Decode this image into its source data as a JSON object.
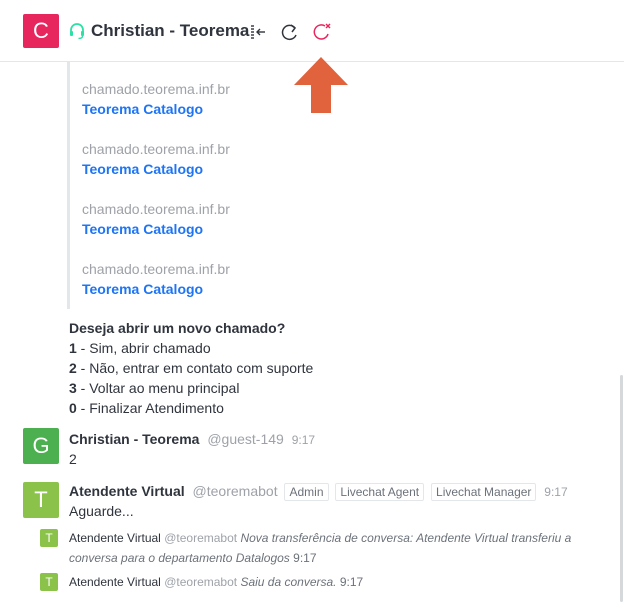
{
  "header": {
    "avatar_letter": "C",
    "title": "Christian - Teorema",
    "avatar_color": "#e8265e",
    "icons": [
      "headset-icon",
      "hide-room-icon",
      "forward-chat-icon",
      "close-chat-icon"
    ]
  },
  "links": [
    {
      "domain": "chamado.teorema.inf.br",
      "title": "Teorema Catalogo"
    },
    {
      "domain": "chamado.teorema.inf.br",
      "title": "Teorema Catalogo"
    },
    {
      "domain": "chamado.teorema.inf.br",
      "title": "Teorema Catalogo"
    },
    {
      "domain": "chamado.teorema.inf.br",
      "title": "Teorema Catalogo"
    }
  ],
  "menu": {
    "question": "Deseja abrir um novo chamado?",
    "options": [
      {
        "key": "1",
        "text": " - Sim, abrir chamado"
      },
      {
        "key": "2",
        "text": " - Não, entrar em contato com suporte"
      },
      {
        "key": "3",
        "text": " - Voltar ao menu principal"
      },
      {
        "key": "0",
        "text": " - Finalizar Atendimento"
      }
    ]
  },
  "messages": [
    {
      "avatar": "G",
      "avatar_color": "#4caf50",
      "user": "Christian - Teorema",
      "handle": "@guest-149",
      "time": "9:17",
      "body": "2"
    },
    {
      "avatar": "T",
      "avatar_color": "#8bc34a",
      "user": "Atendente Virtual",
      "handle": "@teoremabot",
      "roles": [
        "Admin",
        "Livechat Agent",
        "Livechat Manager"
      ],
      "time": "9:17",
      "body": "Aguarde..."
    }
  ],
  "system": [
    {
      "avatar": "T",
      "user": "Atendente Virtual",
      "handle": "@teoremabot",
      "text": "Nova transferência de conversa: Atendente Virtual transferiu a conversa para o departamento Datalogos",
      "time": "9:17"
    },
    {
      "avatar": "T",
      "user": "Atendente Virtual",
      "handle": "@teoremabot",
      "text": "Saiu da conversa.",
      "time": "9:17"
    }
  ],
  "colors": {
    "link": "#1d74f5",
    "accent": "#e8265e",
    "annotation_arrow": "#e0633e"
  }
}
